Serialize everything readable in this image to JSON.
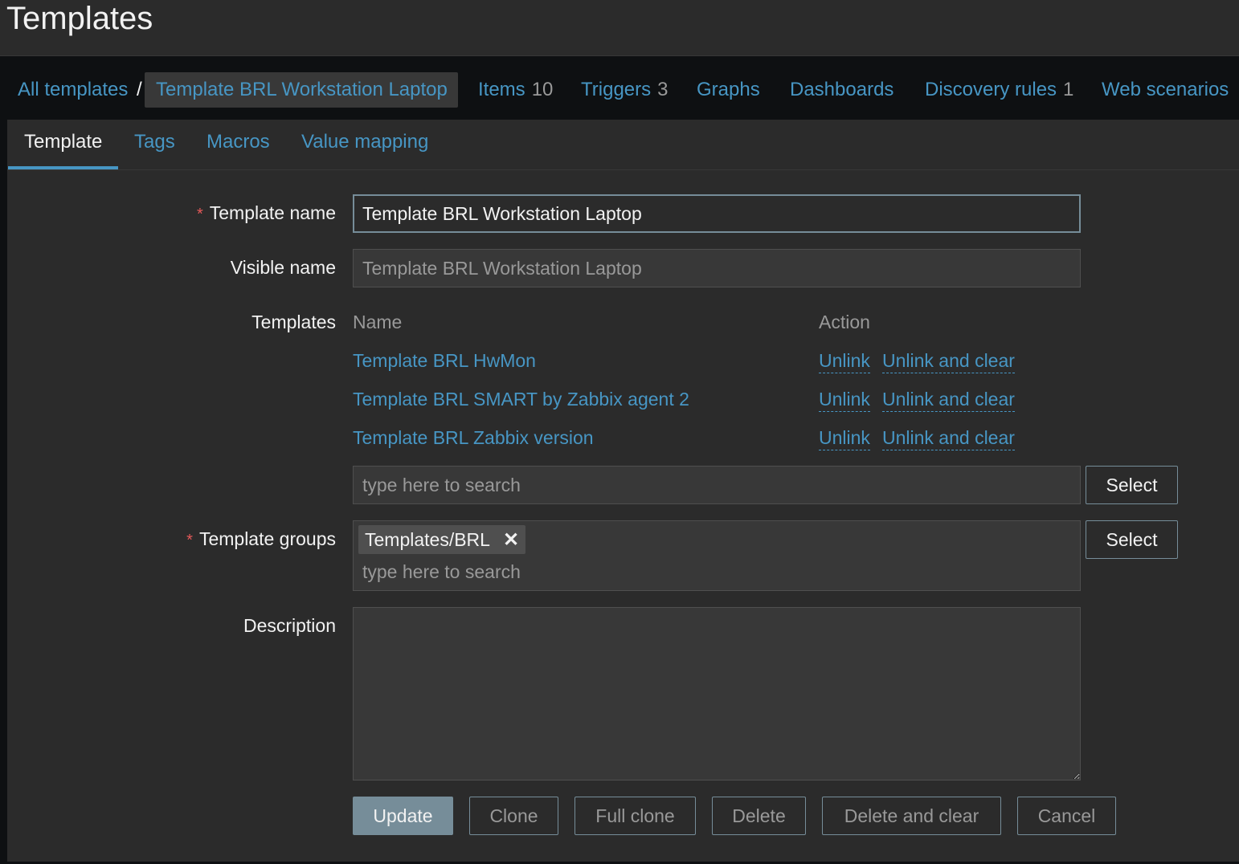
{
  "header": {
    "title": "Templates"
  },
  "nav": {
    "breadcrumb_root": "All templates",
    "separator": "/",
    "breadcrumb_current": "Template BRL Workstation Laptop",
    "items_label": "Items",
    "items_count": "10",
    "triggers_label": "Triggers",
    "triggers_count": "3",
    "graphs_label": "Graphs",
    "dashboards_label": "Dashboards",
    "discovery_label": "Discovery rules",
    "discovery_count": "1",
    "web_label": "Web scenarios"
  },
  "tabs": [
    "Template",
    "Tags",
    "Macros",
    "Value mapping"
  ],
  "form": {
    "template_name_label": "Template name",
    "template_name_value": "Template BRL Workstation Laptop",
    "visible_name_label": "Visible name",
    "visible_name_placeholder": "Template BRL Workstation Laptop",
    "templates_label": "Templates",
    "col_name": "Name",
    "col_action": "Action",
    "linked": [
      {
        "name": "Template BRL HwMon",
        "unlink": "Unlink",
        "unlink_clear": "Unlink and clear"
      },
      {
        "name": "Template BRL SMART by Zabbix agent 2",
        "unlink": "Unlink",
        "unlink_clear": "Unlink and clear"
      },
      {
        "name": "Template BRL Zabbix version",
        "unlink": "Unlink",
        "unlink_clear": "Unlink and clear"
      }
    ],
    "search_placeholder": "type here to search",
    "select_label": "Select",
    "groups_label": "Template groups",
    "group_chip": "Templates/BRL",
    "chip_remove": "✕",
    "groups_placeholder": "type here to search",
    "description_label": "Description",
    "description_value": ""
  },
  "buttons": {
    "update": "Update",
    "clone": "Clone",
    "full_clone": "Full clone",
    "delete": "Delete",
    "delete_clear": "Delete and clear",
    "cancel": "Cancel"
  },
  "colors": {
    "background": "#2b2b2b",
    "link": "#4796c4",
    "required": "#e45959",
    "primary_button": "#768d99"
  }
}
